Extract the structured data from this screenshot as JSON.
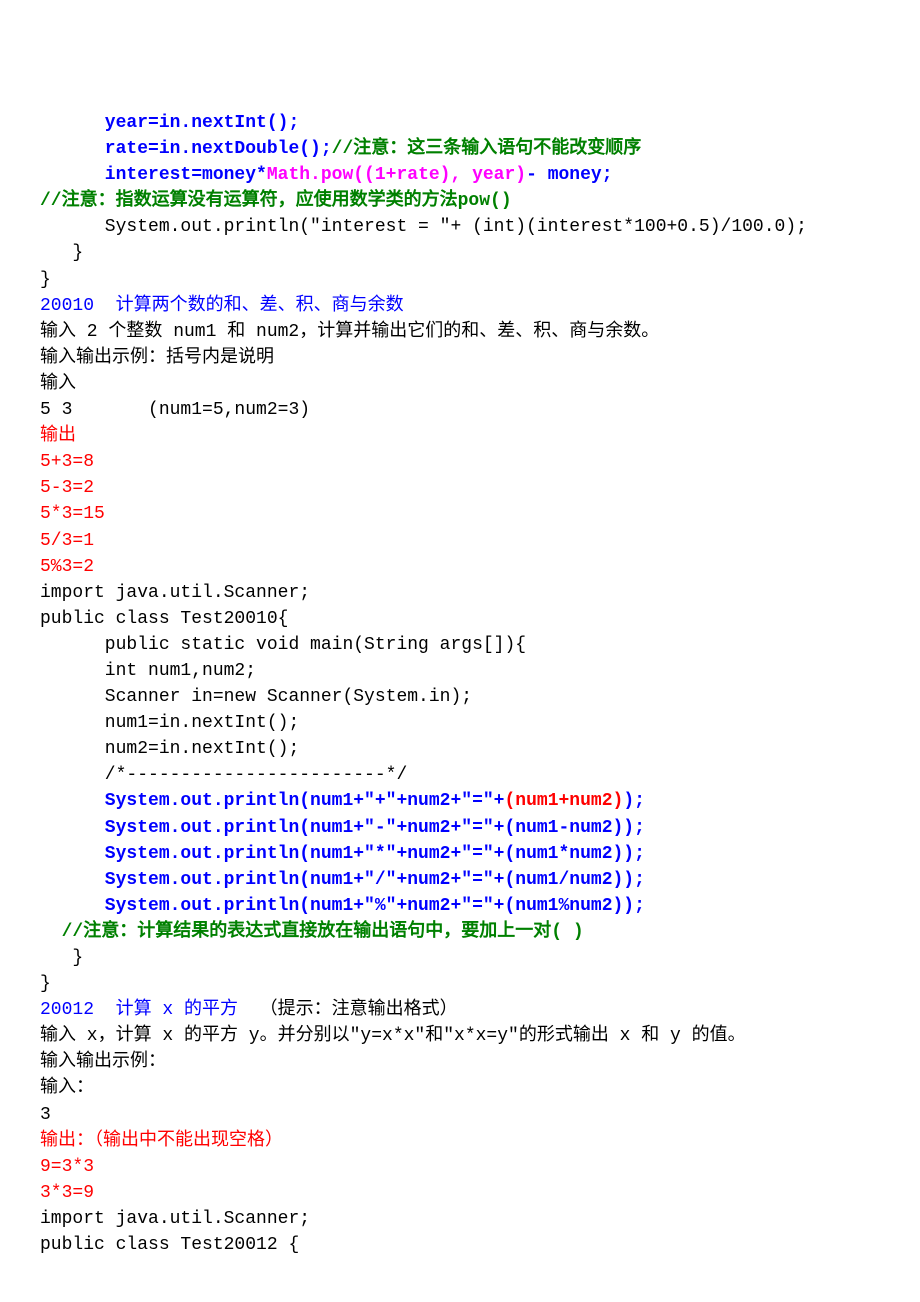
{
  "section1": {
    "l1_a": "      year=in.nextInt();",
    "l2_a": "      rate=in.nextDouble();",
    "l2_b": "//注意：这三条输入语句不能改变顺序",
    "l3_a": "      interest=money*",
    "l3_b": "Math.pow((1+rate), year)",
    "l3_c": "- money;",
    "l4": "//注意：指数运算没有运算符，应使用数学类的方法",
    "l4_b": "pow()",
    "l5": "      System.out.println(\"interest = \"+ (int)(interest*100+0.5)/100.0);",
    "l6": "   }",
    "l7": "}"
  },
  "problem1": {
    "title": "20010  计算两个数的和、差、积、商与余数",
    "desc": "输入 2 个整数 num1 和 num2，计算并输出它们的和、差、积、商与余数。",
    "io_label": "输入输出示例：括号内是说明",
    "input_label": "输入",
    "input_val": "5 3       (num1=5,num2=3)",
    "output_label": "输出",
    "out1": "5+3=8",
    "out2": "5-3=2",
    "out3": "5*3=15",
    "out4": "5/3=1",
    "out5": "5%3=2",
    "code1": "import java.util.Scanner;",
    "code2": "public class Test20010{",
    "code3": "      public static void main(String args[]){",
    "code4": "      int num1,num2;",
    "code5": "      Scanner in=new Scanner(System.in);",
    "code6": "      num1=in.nextInt();",
    "code7": "      num2=in.nextInt();",
    "code8": "      /*------------------------*/",
    "code9_a": "      System.out.println(num1+\"+\"+num2+\"=\"+",
    "code9_b": "(num1+num2)",
    "code9_c": ");",
    "code10": "      System.out.println(num1+\"-\"+num2+\"=\"+(num1-num2));",
    "code11": "      System.out.println(num1+\"*\"+num2+\"=\"+(num1*num2));",
    "code12": "      System.out.println(num1+\"/\"+num2+\"=\"+(num1/num2));",
    "code13": "      System.out.println(num1+\"%\"+num2+\"=\"+(num1%num2));",
    "note_a": "  //注意：计算结果的表达式直接放在输出语句中，要加上一对",
    "note_b": "( )",
    "code14": "   }",
    "code15": "}"
  },
  "problem2": {
    "title_a": "20012  计算 x 的平方",
    "title_b": "  （提示：注意输出格式）",
    "desc": "输入 x，计算 x 的平方 y。并分别以\"y=x*x\"和\"x*x=y\"的形式输出 x 和 y 的值。",
    "io_label": "输入输出示例：",
    "input_label": "输入：",
    "input_val": "3",
    "output_label": "输出：（输出中不能出现空格）",
    "out1": "9=3*3",
    "out2": "3*3=9",
    "code1": "import java.util.Scanner;",
    "code2": "public class Test20012 {"
  }
}
